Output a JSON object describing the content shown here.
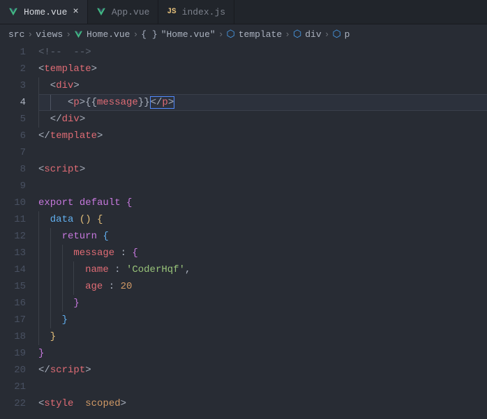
{
  "tabs": [
    {
      "label": "Home.vue",
      "type": "vue",
      "active": true,
      "close": "×"
    },
    {
      "label": "App.vue",
      "type": "vue",
      "active": false
    },
    {
      "label": "index.js",
      "type": "js",
      "active": false
    }
  ],
  "breadcrumb": {
    "sep": "›",
    "items": [
      {
        "label": "src",
        "icon": null
      },
      {
        "label": "views",
        "icon": null
      },
      {
        "label": "Home.vue",
        "icon": "vue"
      },
      {
        "label": "\"Home.vue\"",
        "icon": "braces"
      },
      {
        "label": "template",
        "icon": "cube"
      },
      {
        "label": "div",
        "icon": "cube"
      },
      {
        "label": "p",
        "icon": "cube"
      }
    ]
  },
  "gutter": {
    "start": 1,
    "end": 22,
    "active": 4
  },
  "code": {
    "l1_open": "<!--",
    "l1_close": "-->",
    "template": "template",
    "div": "div",
    "p": "p",
    "mustache_open": "{{",
    "mustache_close": "}}",
    "message_var": "message",
    "script": "script",
    "export": "export",
    "default": "default",
    "data": "data",
    "return": "return",
    "message_prop": "message",
    "name_prop": "name",
    "name_val": "'CoderHqf'",
    "age_prop": "age",
    "age_val": "20",
    "style": "style",
    "scoped": "scoped",
    "lt": "<",
    "gt": ">",
    "slash": "/",
    "colon": ":",
    "comma": ",",
    "lparen": "(",
    "rparen": ")",
    "lbrace": "{",
    "rbrace": "}",
    "sp2": "  "
  }
}
